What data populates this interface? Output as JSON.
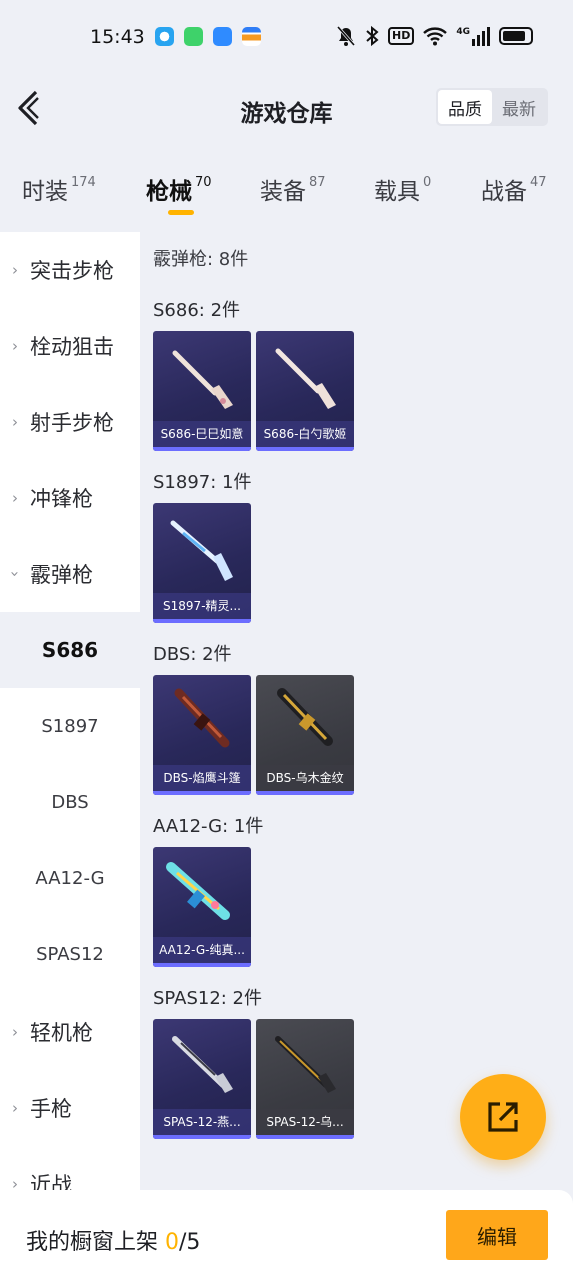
{
  "status_bar": {
    "time": "15:43",
    "icons": [
      "mute-icon",
      "bluetooth-icon",
      "hd-icon",
      "wifi-icon",
      "signal-4g-icon",
      "battery-icon"
    ],
    "hd_label": "HD",
    "net_label": "4G"
  },
  "header": {
    "title": "游戏仓库",
    "sort_options": [
      "品质",
      "最新"
    ],
    "active_sort": "品质"
  },
  "tabs": [
    {
      "label": "时装",
      "count": "174"
    },
    {
      "label": "枪械",
      "count": "70",
      "active": true
    },
    {
      "label": "装备",
      "count": "87"
    },
    {
      "label": "载具",
      "count": "0"
    },
    {
      "label": "战备",
      "count": "47"
    }
  ],
  "sidebar": {
    "items": [
      {
        "label": "突击步枪",
        "expanded": false
      },
      {
        "label": "栓动狙击",
        "expanded": false
      },
      {
        "label": "射手步枪",
        "expanded": false
      },
      {
        "label": "冲锋枪",
        "expanded": false
      },
      {
        "label": "霰弹枪",
        "expanded": true
      },
      {
        "label": "S686",
        "sub": true,
        "selected": true
      },
      {
        "label": "S1897",
        "sub": true
      },
      {
        "label": "DBS",
        "sub": true
      },
      {
        "label": "AA12-G",
        "sub": true
      },
      {
        "label": "SPAS12",
        "sub": true
      },
      {
        "label": "轻机枪",
        "expanded": false
      },
      {
        "label": "手枪",
        "expanded": false
      },
      {
        "label": "近战",
        "expanded": false
      }
    ]
  },
  "content": {
    "total": "霰弹枪: 8件",
    "groups": [
      {
        "title": "S686: 2件",
        "items": [
          {
            "name": "S686-巳巳如意",
            "style": "purple"
          },
          {
            "name": "S686-白勺歌姬",
            "style": "purple"
          }
        ]
      },
      {
        "title": "S1897: 1件",
        "items": [
          {
            "name": "S1897-精灵...",
            "style": "purple"
          }
        ]
      },
      {
        "title": "DBS: 2件",
        "items": [
          {
            "name": "DBS-焰鹰斗篷",
            "style": "purple"
          },
          {
            "name": "DBS-乌木金纹",
            "style": "gold"
          }
        ]
      },
      {
        "title": "AA12-G: 1件",
        "items": [
          {
            "name": "AA12-G-纯真...",
            "style": "purple"
          }
        ]
      },
      {
        "title": "SPAS12: 2件",
        "items": [
          {
            "name": "SPAS-12-燕...",
            "style": "purple"
          },
          {
            "name": "SPAS-12-乌...",
            "style": "gold"
          }
        ]
      }
    ]
  },
  "bottom_bar": {
    "shelf_label": "我的橱窗上架",
    "shelf_current": "0",
    "shelf_total": "/5",
    "edit_label": "编辑"
  },
  "colors": {
    "accent": "#ffb300",
    "card_purple": "#2b2a5e",
    "card_gold": "#3a3b42",
    "card_bar": "#6c6dff"
  }
}
